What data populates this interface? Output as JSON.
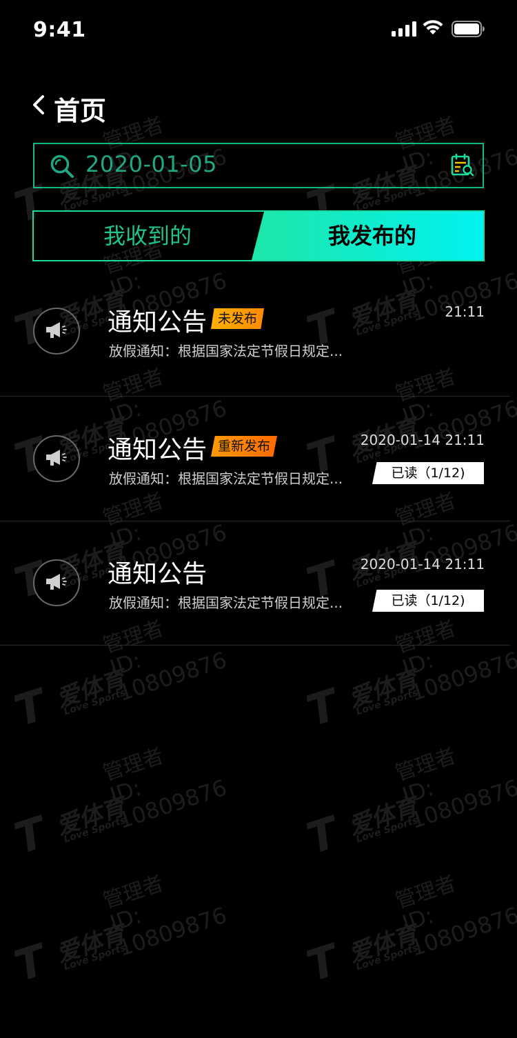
{
  "status_bar": {
    "time": "9:41"
  },
  "nav": {
    "back_icon": "chevron-left-icon",
    "title": "首页"
  },
  "search": {
    "icon": "search-icon",
    "value": "2020-01-05",
    "calendar_icon": "calendar-search-icon"
  },
  "tabs": [
    {
      "label": "我收到的",
      "active": false
    },
    {
      "label": "我发布的",
      "active": true
    }
  ],
  "notices": [
    {
      "icon": "megaphone-icon",
      "title": "通知公告",
      "badge": "未发布",
      "desc": "放假通知：根据国家法定节假日规定...",
      "time": "21:11",
      "read": ""
    },
    {
      "icon": "megaphone-icon",
      "title": "通知公告",
      "badge": "重新发布",
      "desc": "放假通知：根据国家法定节假日规定...",
      "time": "2020-01-14 21:11",
      "read": "已读（1/12)"
    },
    {
      "icon": "megaphone-icon",
      "title": "通知公告",
      "badge": "",
      "desc": "放假通知：根据国家法定节假日规定...",
      "time": "2020-01-14 21:11",
      "read": "已读（1/12)"
    }
  ],
  "watermark": {
    "brand": "爱体育",
    "brand_sub": "Love Sports",
    "role": "管理者",
    "uid": "ID: 10809876"
  },
  "colors": {
    "accent": "#1edca0",
    "search_text": "#1ea884",
    "badge_orange": "#ff9a00"
  }
}
